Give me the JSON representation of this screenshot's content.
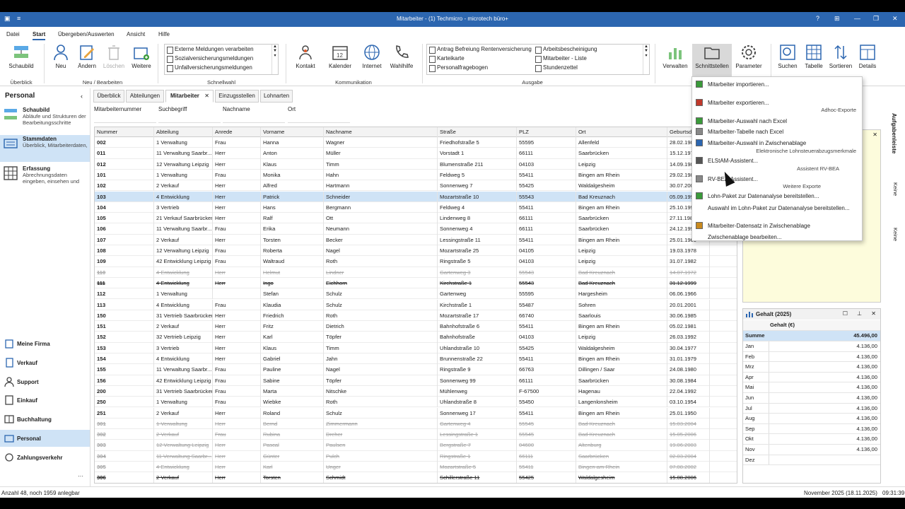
{
  "titlebar": {
    "title": "Mitarbeiter - (1) Techmicro - microtech büro+"
  },
  "menu": [
    "Datei",
    "Start",
    "Übergeben/Auswerten",
    "Ansicht",
    "Hilfe"
  ],
  "ribbon": {
    "schaubild": "Schaubild",
    "neu": "Neu",
    "aendern": "Ändern",
    "loeschen": "Löschen",
    "weitere": "Weitere",
    "kontakt": "Kontakt",
    "kalender": "Kalender",
    "internet": "Internet",
    "wahlhilfe": "Wahlhilfe",
    "verwalten": "Verwalten",
    "schnittstellen": "Schnittstellen",
    "parameter": "Parameter",
    "suchen": "Suchen",
    "tabelle": "Tabelle",
    "sortieren": "Sortieren",
    "details": "Details",
    "groups": {
      "ueberblick": "Überblick",
      "neu_bearbeiten": "Neu / Bearbeiten",
      "schnellwahl": "Schnellwahl",
      "kommunikation": "Kommunikation",
      "ausgabe": "Ausgabe"
    },
    "schnellwahl": [
      "Externe Meldungen verarbeiten",
      "Sozialversicherungsmeldungen",
      "Unfallversicherungsmeldungen"
    ],
    "ausgabe_left": [
      "Antrag Befreiung Rentenversicherung",
      "Karteikarte",
      "Personalfragebogen"
    ],
    "ausgabe_right": [
      "Arbeitsbescheinigung",
      "Mitarbeiter - Liste",
      "Stundenzettel"
    ]
  },
  "sidebar": {
    "header": "Personal",
    "items": [
      {
        "title": "Schaubild",
        "desc": "Abläufe und Strukturen der Bearbeitungsschritte"
      },
      {
        "title": "Stammdaten",
        "desc": "Überblick, Mitarbeiterdaten,"
      },
      {
        "title": "Erfassung",
        "desc": "Abrechnungsdaten eingeben, einsehen und"
      }
    ],
    "nav": [
      "Meine Firma",
      "Verkauf",
      "Support",
      "Einkauf",
      "Buchhaltung",
      "Personal",
      "Zahlungsverkehr"
    ]
  },
  "tabs": [
    "Überblick",
    "Abteilungen",
    "Mitarbeiter",
    "Einzugsstellen",
    "Lohnarten"
  ],
  "filters": [
    "Mitarbeiternummer",
    "Suchbegriff",
    "Nachname",
    "Ort"
  ],
  "grid": {
    "columns": [
      "Nummer",
      "Abteilung",
      "Anrede",
      "Vorname",
      "Nachname",
      "Straße",
      "PLZ",
      "Ort",
      "Geburtsd"
    ],
    "rows": [
      [
        "002",
        "1 Verwaltung",
        "Frau",
        "Hanna",
        "Wagner",
        "Friedhofstraße 5",
        "55595",
        "Allenfeld",
        "28.02.198"
      ],
      [
        "011",
        "11 Verwaltung Saarbr...",
        "Herr",
        "Anton",
        "Müller",
        "Vorstadt 1",
        "66111",
        "Saarbrücken",
        "15.12.197"
      ],
      [
        "012",
        "12 Verwaltung Leipzig",
        "Herr",
        "Klaus",
        "Timm",
        "Blumenstraße 211",
        "04103",
        "Leipzig",
        "14.09.198"
      ],
      [
        "101",
        "1 Verwaltung",
        "Frau",
        "Monika",
        "Hahn",
        "Feldweg 5",
        "55411",
        "Bingen am Rhein",
        "29.02.198"
      ],
      [
        "102",
        "2 Verkauf",
        "Herr",
        "Alfred",
        "Hartmann",
        "Sonnenweg 7",
        "55425",
        "Waldalgesheim",
        "30.07.200"
      ],
      [
        "103",
        "4 Entwicklung",
        "Herr",
        "Patrick",
        "Schneider",
        "Mozartstraße 10",
        "55543",
        "Bad Kreuznach",
        "05.09.199"
      ],
      [
        "104",
        "3 Vertrieb",
        "Herr",
        "Hans",
        "Bergmann",
        "Feldweg 4",
        "55411",
        "Bingen am Rhein",
        "25.10.1993"
      ],
      [
        "105",
        "21 Verkauf Saarbrücken",
        "Herr",
        "Ralf",
        "Ott",
        "Lindenweg 8",
        "66111",
        "Saarbrücken",
        "27.11.1983"
      ],
      [
        "106",
        "11 Verwaltung Saarbr...",
        "Frau",
        "Erika",
        "Neumann",
        "Sonnenweg 4",
        "66111",
        "Saarbrücken",
        "24.12.1993"
      ],
      [
        "107",
        "2 Verkauf",
        "Herr",
        "Torsten",
        "Becker",
        "Lessingstraße 11",
        "55411",
        "Bingen am Rhein",
        "25.01.1965"
      ],
      [
        "108",
        "12 Verwaltung Leipzig",
        "Frau",
        "Roberta",
        "Nagel",
        "Mozartstraße 25",
        "04105",
        "Leipzig",
        "19.03.1978"
      ],
      [
        "109",
        "42 Entwicklung Leipzig",
        "Frau",
        "Waltraud",
        "Roth",
        "Ringstraße 5",
        "04103",
        "Leipzig",
        "31.07.1982"
      ],
      [
        "110",
        "4 Entwicklung",
        "Herr",
        "Helmut",
        "Lindner",
        "Gartenweg 3",
        "55543",
        "Bad Kreuznach",
        "14.07.1972"
      ],
      [
        "111",
        "4 Entwicklung",
        "Herr",
        "Ingo",
        "Eichhorn",
        "Kirchstraße 1",
        "55543",
        "Bad Kreuznach",
        "31.12.1999"
      ],
      [
        "112",
        "1 Verwaltung",
        "",
        "Stefan",
        "Schulz",
        "Gartenweg",
        "55595",
        "Hargesheim",
        "06.06.1966"
      ],
      [
        "113",
        "4 Entwicklung",
        "Frau",
        "Klaudia",
        "Schulz",
        "Kirchstraße 1",
        "55487",
        "Sohren",
        "20.01.2001"
      ],
      [
        "150",
        "31 Vertrieb Saarbrücken",
        "Herr",
        "Friedrich",
        "Roth",
        "Mozartstraße 17",
        "66740",
        "Saarlouis",
        "30.06.1985"
      ],
      [
        "151",
        "2 Verkauf",
        "Herr",
        "Fritz",
        "Dietrich",
        "Bahnhofstraße 6",
        "55411",
        "Bingen am Rhein",
        "05.02.1981"
      ],
      [
        "152",
        "32 Vertrieb Leipzig",
        "Herr",
        "Karl",
        "Töpfer",
        "Bahnhofstraße",
        "04103",
        "Leipzig",
        "26.03.1992"
      ],
      [
        "153",
        "3 Vertrieb",
        "Herr",
        "Klaus",
        "Timm",
        "Uhlandstraße 10",
        "55425",
        "Waldalgesheim",
        "30.04.1977"
      ],
      [
        "154",
        "4 Entwicklung",
        "Herr",
        "Gabriel",
        "Jahn",
        "Brunnenstraße 22",
        "55411",
        "Bingen am Rhein",
        "31.01.1979"
      ],
      [
        "155",
        "11 Verwaltung Saarbr...",
        "Frau",
        "Pauline",
        "Nagel",
        "Ringstraße 9",
        "66763",
        "Dillingen / Saar",
        "24.08.1980"
      ],
      [
        "156",
        "42 Entwicklung Leipzig",
        "Frau",
        "Sabine",
        "Töpfer",
        "Sonnenweg 99",
        "66111",
        "Saarbrücken",
        "30.08.1984"
      ],
      [
        "200",
        "31 Vertrieb Saarbrücken",
        "Frau",
        "Marta",
        "Nitschke",
        "Mühlenweg",
        "F-67500",
        "Hagenau",
        "22.04.1992"
      ],
      [
        "250",
        "1 Verwaltung",
        "Frau",
        "Wiebke",
        "Roth",
        "Uhlandstraße 8",
        "55450",
        "Langenlonsheim",
        "03.10.1954"
      ],
      [
        "251",
        "2 Verkauf",
        "Herr",
        "Roland",
        "Schulz",
        "Sonnenweg 17",
        "55411",
        "Bingen am Rhein",
        "25.01.1950"
      ],
      [
        "301",
        "1 Verwaltung",
        "Herr",
        "Bernd",
        "Zimmermann",
        "Gartenweg 4",
        "55545",
        "Bad Kreuznach",
        "15.03.2004"
      ],
      [
        "302",
        "2 Verkauf",
        "Frau",
        "Rubina",
        "Dreher",
        "Lessingstraße 1",
        "55545",
        "Bad Kreuznach",
        "15.05.2006"
      ],
      [
        "303",
        "12 Verwaltung Leipzig",
        "Herr",
        "Pascal",
        "Paulsen",
        "Bergstraße 7",
        "04600",
        "Altenburg",
        "19.06.2003"
      ],
      [
        "304",
        "11 Verwaltung Saarbr...",
        "Herr",
        "Günter",
        "Pulch",
        "Ringstraße 1",
        "66111",
        "Saarbrücken",
        "02.03.2004"
      ],
      [
        "305",
        "4 Entwicklung",
        "Herr",
        "Karl",
        "Unger",
        "Mozartstraße 5",
        "55411",
        "Bingen am Rhein",
        "07.08.2002"
      ],
      [
        "306",
        "2 Verkauf",
        "Herr",
        "Torsten",
        "Schmidt",
        "Schillerstraße 11",
        "55425",
        "Waldalgesheim",
        "15.08.2006"
      ]
    ]
  },
  "dropdown": {
    "items": [
      "Mitarbeiter importieren...",
      "Mitarbeiter exportieren...",
      "Mitarbeiter-Auswahl nach Excel",
      "Mitarbeiter-Tabelle nach Excel",
      "Mitarbeiter-Auswahl in Zwischenablage",
      "ELStAM-Assistent...",
      "RV-BEA-Assistent...",
      "Lohn-Paket zur Datenanalyse bereitstellen...",
      "Auswahl im Lohn-Paket zur Datenanalyse bereitstellen...",
      "Mitarbeiter-Datensatz in Zwischenablage",
      "Zwischenablage bearbeiten..."
    ],
    "sections": [
      "Adhoc-Exporte",
      "Elektronische Lohnsteuerabzugsmerkmale",
      "Assistent RV-BEA",
      "Weitere Exporte"
    ]
  },
  "gehalt": {
    "title": "Gehalt (2025)",
    "col": "Gehalt (€)",
    "summe_label": "Summe",
    "summe": "45.496,00",
    "months": [
      [
        "Jan",
        "4.136,00"
      ],
      [
        "Feb",
        "4.136,00"
      ],
      [
        "Mrz",
        "4.136,00"
      ],
      [
        "Apr",
        "4.136,00"
      ],
      [
        "Mai",
        "4.136,00"
      ],
      [
        "Jun",
        "4.136,00"
      ],
      [
        "Jul",
        "4.136,00"
      ],
      [
        "Aug",
        "4.136,00"
      ],
      [
        "Sep",
        "4.136,00"
      ],
      [
        "Okt",
        "4.136,00"
      ],
      [
        "Nov",
        "4.136,00"
      ],
      [
        "Dez",
        ""
      ]
    ]
  },
  "vtabs": [
    "Aufgabenleiste",
    "Keine",
    "Keine"
  ],
  "status": {
    "left": "Anzahl 48, noch 1959 anlegbar",
    "date": "November 2025  (18.11.2025)",
    "time": "09:31:39"
  },
  "colors": {
    "titlebar": "#2c66b0",
    "selection": "#cfe3f6"
  }
}
